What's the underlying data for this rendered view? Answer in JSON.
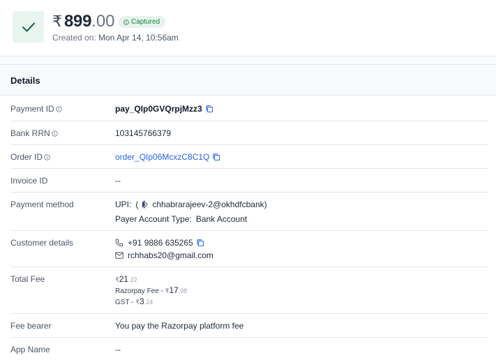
{
  "header": {
    "currency_symbol": "₹",
    "amount_int": "899",
    "amount_dec": ".00",
    "status": "Captured",
    "created_label": "Created on:",
    "created_value": "Mon Apr 14, 10:56am"
  },
  "details": {
    "title": "Details",
    "payment_id": {
      "label": "Payment ID",
      "value": "pay_QIp0GVQrpjMzz3"
    },
    "bank_rrn": {
      "label": "Bank RRN",
      "value": "103145766379"
    },
    "order_id": {
      "label": "Order ID",
      "value": "order_QIp06McxzC8C1Q"
    },
    "invoice_id": {
      "label": "Invoice ID",
      "value": "--"
    },
    "payment_method": {
      "label": "Payment method",
      "upi_prefix": "UPI:",
      "open_paren": "(",
      "vpa": "chhabrarajeev-2@okhdfcbank",
      "close_paren": ")",
      "payer_type_label": "Payer Account Type:",
      "payer_type_value": "Bank Account"
    },
    "customer": {
      "label": "Customer details",
      "phone": "+91 9886 635265",
      "email": "rchhabs20@gmail.com"
    },
    "total_fee": {
      "label": "Total Fee",
      "symbol": "₹",
      "int": "21",
      "dec": ".22",
      "razorpay_label": "Razorpay Fee - ",
      "razorpay_symbol": "₹",
      "razorpay_int": "17",
      "razorpay_dec": ".98",
      "gst_label": "GST - ",
      "gst_symbol": "₹",
      "gst_int": "3",
      "gst_dec": ".24"
    },
    "fee_bearer": {
      "label": "Fee bearer",
      "value": "You pay the Razorpay platform fee"
    },
    "app_name": {
      "label": "App Name",
      "value": "--"
    }
  },
  "colors": {
    "accent_blue": "#2563eb",
    "success_green": "#15803d",
    "badge_bg": "#e6f4ec"
  }
}
